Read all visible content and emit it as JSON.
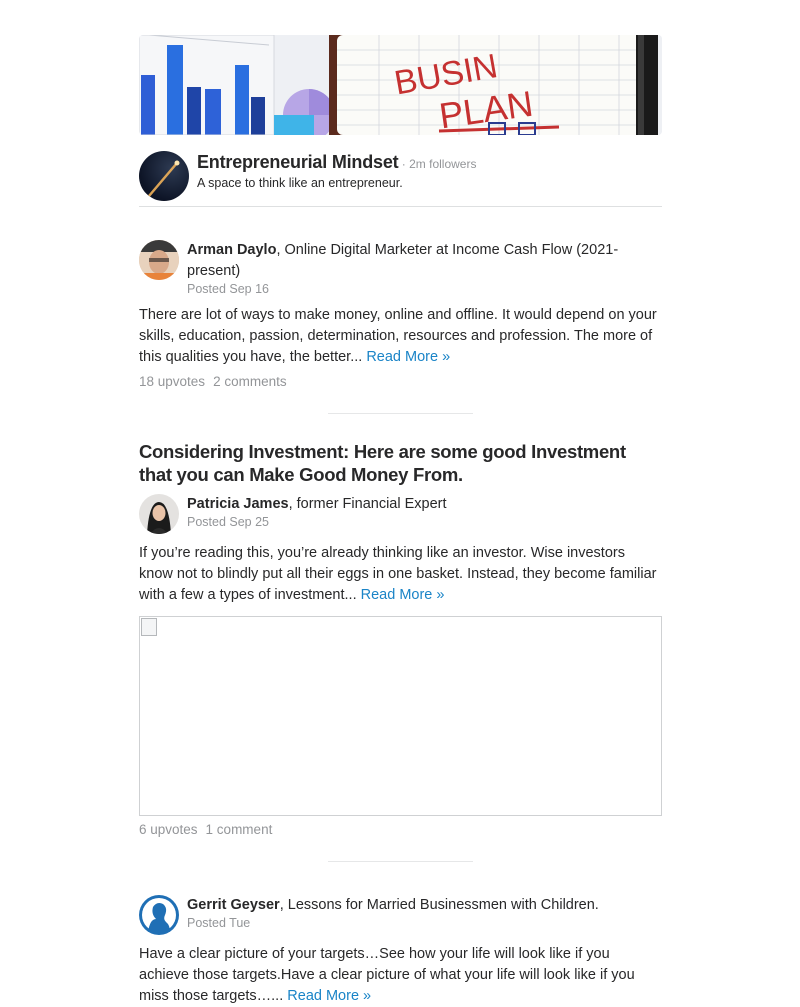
{
  "space": {
    "title": "Entrepreneurial Mindset",
    "followers": " · 2m followers",
    "description": "A space to think like an entrepreneur.",
    "banner_text_1": "BUSIN",
    "banner_text_2": "PLAN"
  },
  "posts": [
    {
      "author": "Arman Daylo",
      "credential": ", Online Digital Marketer at Income Cash Flow (2021-present)",
      "posted": "Posted Sep 16",
      "body": "There are lot of ways to make money, online and offline. It would depend on your skills, education, passion, determination, resources and profession. The more of this qualities you have, the better... ",
      "read_more": "Read More »",
      "upvotes": "18 upvotes",
      "comments": "2 comments"
    },
    {
      "title": "Considering Investment: Here are some good Investment that you can Make Good Money From.",
      "author": "Patricia James",
      "credential": ", former Financial Expert",
      "posted": "Posted Sep 25",
      "body": "If you’re reading this, you’re already thinking like an investor. Wise investors know not to blindly put all their eggs in one basket. Instead, they become familiar with a few a types of investment... ",
      "read_more": "Read More »",
      "upvotes": "6 upvotes",
      "comments": "1 comment"
    },
    {
      "author": "Gerrit Geyser",
      "credential": ", Lessons for Married Businessmen with Children.",
      "posted": "Posted Tue",
      "body": "Have a clear picture of your targets…See how your life will look like if you achieve those targets.Have a clear picture of what your life will look like if you miss those targets…... ",
      "read_more": "Read More »"
    }
  ],
  "colors": {
    "link": "#1a84c7",
    "muted": "#939598",
    "text": "#282829"
  }
}
